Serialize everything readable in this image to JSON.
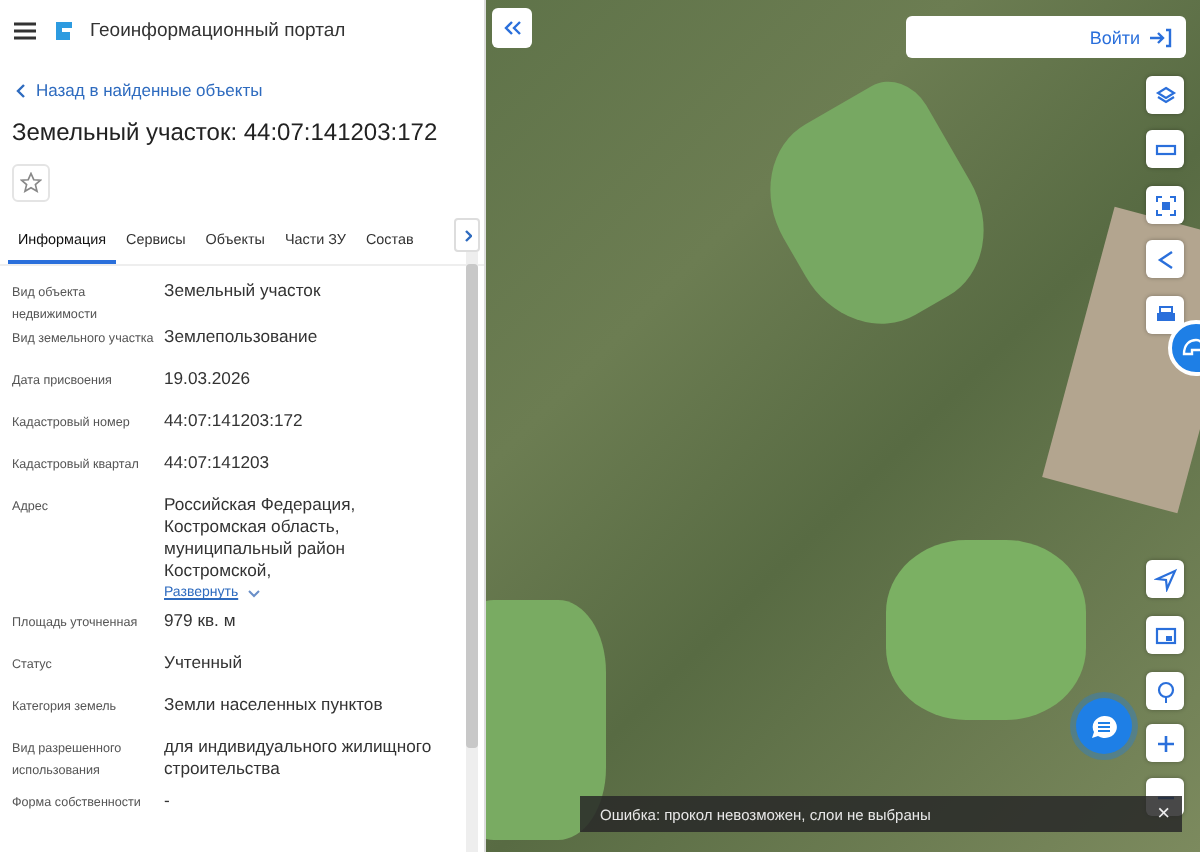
{
  "header": {
    "title": "Геоинформационный портал"
  },
  "back_link": "Назад в найденные объекты",
  "object_title": "Земельный участок: 44:07:141203:172",
  "favorite": {
    "selected": false
  },
  "tabs": [
    {
      "label": "Информация",
      "selected": true
    },
    {
      "label": "Сервисы",
      "selected": false
    },
    {
      "label": "Объекты",
      "selected": false
    },
    {
      "label": "Части ЗУ",
      "selected": false
    },
    {
      "label": "Состав",
      "selected": false
    }
  ],
  "fields": [
    {
      "label": "Вид объекта недвижимости",
      "value": "Земельный участок"
    },
    {
      "label": "Вид земельного участка",
      "value": "Землепользование"
    },
    {
      "label": "Дата присвоения",
      "value": "19.03.2026"
    },
    {
      "label": "Кадастровый номер",
      "value": "44:07:141203:172"
    },
    {
      "label": "Кадастровый квартал",
      "value": "44:07:141203"
    },
    {
      "label": "Адрес",
      "value": "Российская Федерация, Костромская область, муниципальный район Костромской,",
      "expand_link": "Развернуть"
    },
    {
      "label": "Площадь уточненная",
      "value": "979 кв. м"
    },
    {
      "label": "Статус",
      "value": "Учтенный"
    },
    {
      "label": "Категория земель",
      "value": "Земли населенных пунктов"
    },
    {
      "label": "Вид разрешенного использования",
      "value": "для индивидуального жилищного строительства"
    },
    {
      "label": "Форма собственности",
      "value": "-"
    }
  ],
  "login_button": "Войти",
  "toast": {
    "message": "Ошибка: прокол невозможен, слои не выбраны",
    "close": "×"
  }
}
